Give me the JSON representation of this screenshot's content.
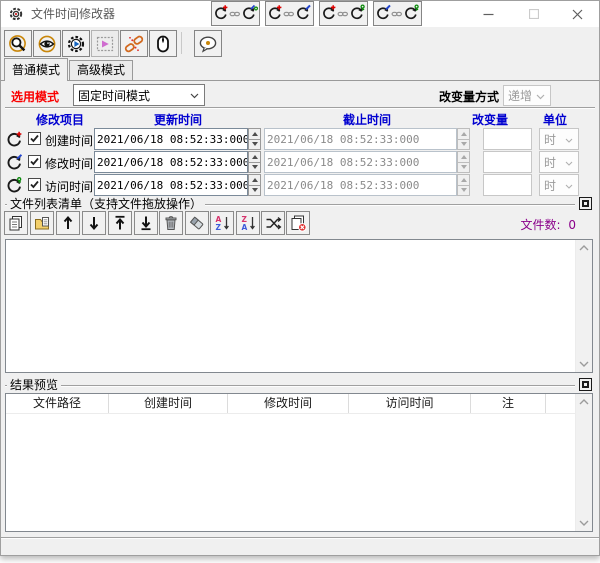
{
  "window": {
    "title": "文件时间修改器"
  },
  "titlebar": {
    "icons": [
      "app-gear",
      "minimize",
      "maximize",
      "close"
    ]
  },
  "toolbar": {
    "icons": [
      "search",
      "eye",
      "run-gear",
      "preview-media",
      "unlink-chain",
      "mouse",
      "help-bubble"
    ]
  },
  "tabs": {
    "normal": "普通模式",
    "advanced": "高级模式"
  },
  "mode": {
    "label": "选用模式",
    "value": "固定时间模式",
    "link_buttons": [
      "link-create-to-modify-access",
      "link-create-to-modify",
      "link-create-to-access",
      "link-modify-to-access"
    ],
    "delta_mode_label": "改变量方式",
    "delta_mode_value": "递增"
  },
  "time_grid": {
    "headers": {
      "item": "修改项目",
      "update": "更新时间",
      "until": "截止时间",
      "delta": "改变量",
      "unit": "单位"
    },
    "rows": [
      {
        "name": "创建时间",
        "checked": true,
        "icon": "clock-create",
        "update": "2021/06/18 08:52:33:000",
        "until": "2021/06/18 08:52:33:000",
        "delta": "",
        "unit": "时"
      },
      {
        "name": "修改时间",
        "checked": true,
        "icon": "clock-modify",
        "update": "2021/06/18 08:52:33:000",
        "until": "2021/06/18 08:52:33:000",
        "delta": "",
        "unit": "时"
      },
      {
        "name": "访问时间",
        "checked": true,
        "icon": "clock-access",
        "update": "2021/06/18 08:52:33:000",
        "until": "2021/06/18 08:52:33:000",
        "delta": "",
        "unit": "时"
      }
    ]
  },
  "file_list": {
    "title": "文件列表清单（支持文件拖放操作）",
    "count_label": "文件数:",
    "count": "0",
    "toolbar_icons": [
      "copy-files",
      "add-folder",
      "move-up",
      "move-down",
      "move-top",
      "move-bottom",
      "delete-trash",
      "clear-eraser",
      "sort-az",
      "sort-za",
      "shuffle",
      "remove-duplicates"
    ]
  },
  "preview": {
    "title": "结果预览",
    "columns": [
      "文件路径",
      "创建时间",
      "修改时间",
      "访问时间",
      "注"
    ]
  },
  "colors": {
    "header_blue": "#0000d0",
    "label_red": "#fa0000",
    "count_purple": "#8a008a",
    "accent_orange": "#c8860a"
  }
}
